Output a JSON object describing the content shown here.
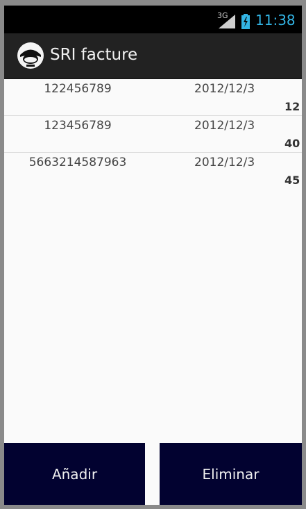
{
  "status_bar": {
    "network": "3G",
    "time": "11:38",
    "colors": {
      "clock": "#33b5e5",
      "battery": "#33b5e5",
      "background": "#000000"
    },
    "icons": [
      "signal-icon",
      "battery-icon"
    ]
  },
  "action_bar": {
    "title": "SRI facture",
    "icon": "app-logo-icon"
  },
  "invoices": [
    {
      "number": "122456789",
      "date": "2012/12/3",
      "amount": "12"
    },
    {
      "number": "123456789",
      "date": "2012/12/3",
      "amount": "40"
    },
    {
      "number": "5663214587963",
      "date": "2012/12/3",
      "amount": "45"
    }
  ],
  "buttons": {
    "add_label": "Añadir",
    "delete_label": "Eliminar",
    "color": "#020230"
  }
}
